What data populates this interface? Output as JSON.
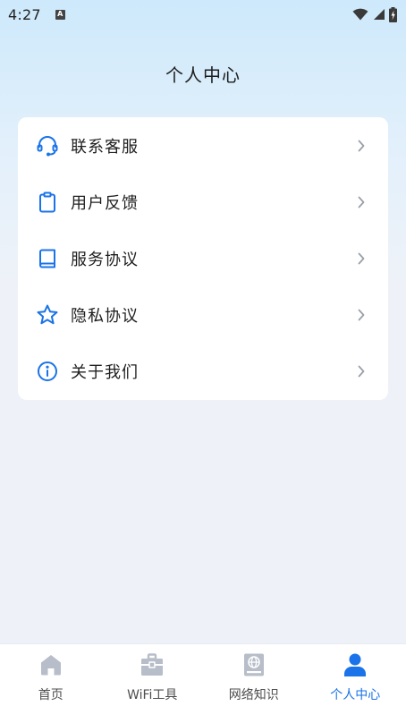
{
  "status_bar": {
    "time": "4:27",
    "notification_badge": "A",
    "icons": [
      "wifi-icon",
      "cellular-signal-icon",
      "battery-charging-icon"
    ]
  },
  "header": {
    "title": "个人中心"
  },
  "menu": {
    "accent_color": "#1a73e8",
    "items": [
      {
        "icon": "headset-icon",
        "label": "联系客服"
      },
      {
        "icon": "clipboard-icon",
        "label": "用户反馈"
      },
      {
        "icon": "book-icon",
        "label": "服务协议"
      },
      {
        "icon": "star-icon",
        "label": "隐私协议"
      },
      {
        "icon": "info-circle-icon",
        "label": "关于我们"
      }
    ]
  },
  "bottom_nav": {
    "active_color": "#1a73e8",
    "inactive_icon_color": "#b7bec9",
    "items": [
      {
        "icon": "home-icon",
        "label": "首页",
        "active": false
      },
      {
        "icon": "toolbox-icon",
        "label": "WiFi工具",
        "active": false
      },
      {
        "icon": "globe-book-icon",
        "label": "网络知识",
        "active": false
      },
      {
        "icon": "person-icon",
        "label": "个人中心",
        "active": true
      }
    ]
  }
}
